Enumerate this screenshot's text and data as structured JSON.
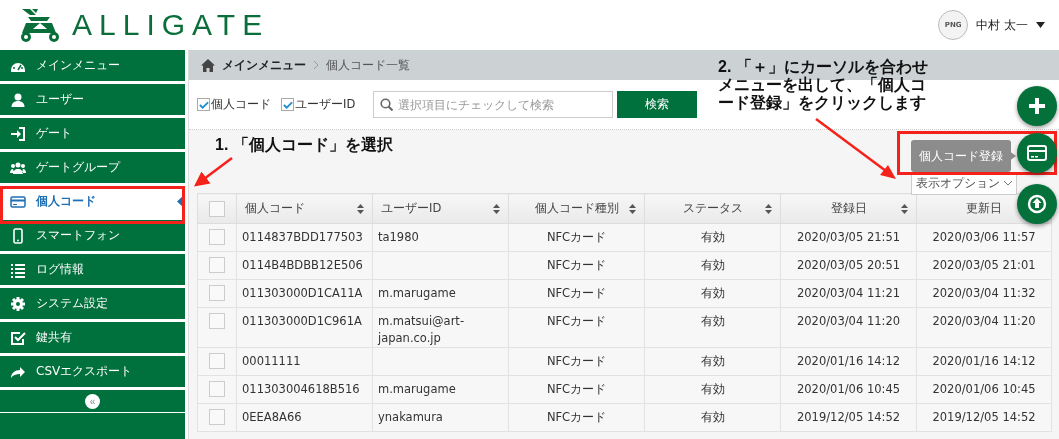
{
  "logo": {
    "text": "ALLIGATE"
  },
  "user": {
    "avatar": "PNG",
    "name": "中村 太一"
  },
  "sidebar": {
    "items": [
      {
        "label": "メインメニュー",
        "kind": "dashboard",
        "selected": false
      },
      {
        "label": "ユーザー",
        "kind": "user",
        "selected": false
      },
      {
        "label": "ゲート",
        "kind": "login",
        "selected": false
      },
      {
        "label": "ゲートグループ",
        "kind": "group",
        "selected": false
      },
      {
        "label": "個人コード",
        "kind": "card",
        "selected": true
      },
      {
        "label": "スマートフォン",
        "kind": "phone",
        "selected": false
      },
      {
        "label": "ログ情報",
        "kind": "list",
        "selected": false
      },
      {
        "label": "システム設定",
        "kind": "gear",
        "selected": false
      },
      {
        "label": "鍵共有",
        "kind": "check",
        "selected": false
      },
      {
        "label": "CSVエクスポート",
        "kind": "share",
        "selected": false
      }
    ],
    "collapse": "«"
  },
  "breadcrumb": [
    "メインメニュー",
    "個人コード一覧"
  ],
  "search": {
    "filters": [
      {
        "label": "個人コード",
        "checked": true
      },
      {
        "label": "ユーザーID",
        "checked": true
      }
    ],
    "placeholder": "選択項目にチェックして検索",
    "button": "検索"
  },
  "display_options": "表示オプション",
  "table": {
    "columns": [
      {
        "label": "個人コード",
        "sortable": true
      },
      {
        "label": "ユーザーID",
        "sortable": true
      },
      {
        "label": "個人コード種別",
        "sortable": true
      },
      {
        "label": "ステータス",
        "sortable": true
      },
      {
        "label": "登録日",
        "sortable": true
      },
      {
        "label": "更新日"
      }
    ],
    "header_checked": false,
    "rows": [
      {
        "checked": false,
        "cells": [
          "0114837BDD177503",
          "ta1980",
          "NFCカード",
          "有効",
          "2020/03/05 21:51",
          "2020/03/06 11:57"
        ]
      },
      {
        "checked": false,
        "cells": [
          "0114B4BDBB12E506",
          "",
          "NFCカード",
          "有効",
          "2020/03/05 20:51",
          "2020/03/05 21:01"
        ]
      },
      {
        "checked": false,
        "cells": [
          "011303000D1CA11A",
          "m.marugame",
          "NFCカード",
          "有効",
          "2020/03/04 11:21",
          "2020/03/04 11:32"
        ]
      },
      {
        "checked": false,
        "cells": [
          "011303000D1C961A",
          "m.matsui@art-japan.co.jp",
          "NFCカード",
          "有効",
          "2020/03/04 11:20",
          "2020/03/04 11:20"
        ]
      },
      {
        "checked": false,
        "cells": [
          "00011111",
          "",
          "NFCカード",
          "有効",
          "2020/01/16 14:12",
          "2020/01/16 14:12"
        ]
      },
      {
        "checked": false,
        "cells": [
          "011303004618B516",
          "m.marugame",
          "NFCカード",
          "有効",
          "2020/01/06 10:45",
          "2020/01/06 10:45"
        ]
      },
      {
        "checked": false,
        "cells": [
          "0EEA8A66",
          "ynakamura",
          "NFCカード",
          "有効",
          "2019/12/05 14:52",
          "2019/12/05 14:52"
        ]
      }
    ]
  },
  "fab": {
    "tooltip": "個人コード登録",
    "buttons": [
      {
        "kind": "add"
      },
      {
        "kind": "card"
      },
      {
        "kind": "top"
      }
    ]
  },
  "annotations": [
    {
      "lines": [
        "1. 「個人コード」を選択"
      ]
    },
    {
      "lines": [
        "2. 「＋」にカーソルを合わせ",
        "メニューを出して、「個人コ",
        "ード登録」をクリックします"
      ]
    }
  ]
}
